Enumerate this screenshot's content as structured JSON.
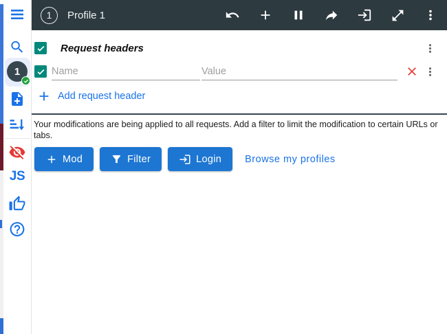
{
  "colors": {
    "topbar_bg": "#2d3a40",
    "accent_blue": "#1a73e8",
    "button_blue": "#1d76d2",
    "checkbox_teal": "#00897b",
    "danger_red": "#e53935",
    "avatar_bg": "#37474f",
    "badge_green": "#1fa23c"
  },
  "topbar": {
    "profile_badge": "1",
    "title": "Profile 1",
    "icons": [
      "undo-icon",
      "add-icon",
      "pause-icon",
      "export-icon",
      "login-icon",
      "open-in-full-icon",
      "more-vert-icon"
    ]
  },
  "sidebar": {
    "icons": [
      "menu-icon",
      "search-icon",
      "profile-avatar",
      "add-file-icon",
      "sort-icon",
      "hide-icon",
      "js-icon",
      "thumb-up-icon",
      "help-icon"
    ],
    "profile_number": "1",
    "js_label": "JS"
  },
  "main": {
    "section_title": "Request headers",
    "row": {
      "name_placeholder": "Name",
      "value_placeholder": "Value",
      "name_value": "",
      "value_value": ""
    },
    "add_header_label": "Add request header",
    "notice": "Your modifications are being applied to all requests. Add a filter to limit the modification to certain URLs or tabs.",
    "mod_button": "Mod",
    "filter_button": "Filter",
    "login_button": "Login",
    "browse_link": "Browse my profiles"
  }
}
